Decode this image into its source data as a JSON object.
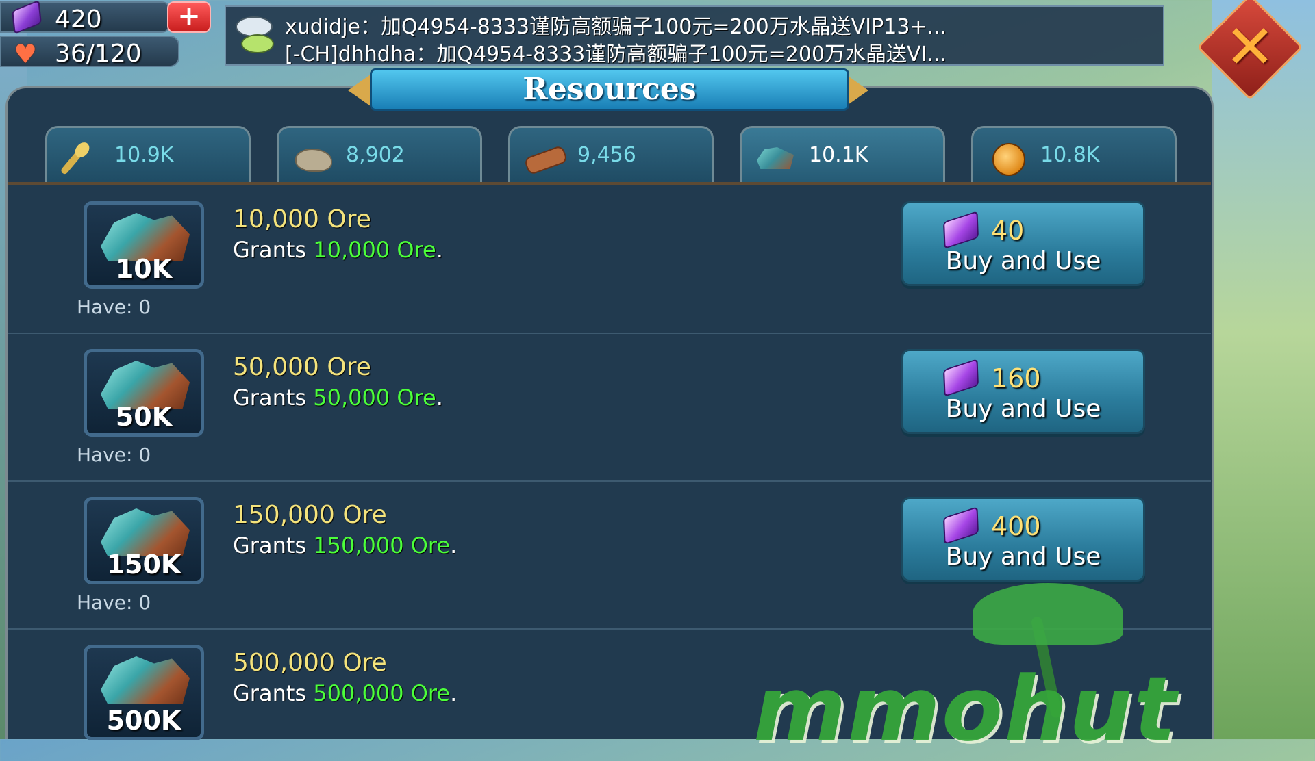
{
  "player": {
    "gems": "420",
    "energy": "36/120"
  },
  "chat": {
    "line1": "xudidje：加Q4954-8333谨防高额骗子100元=200万水晶送VIP13+...",
    "line2": "[-CH]dhhdha：加Q4954-8333谨防高额骗子100元=200万水晶送VI..."
  },
  "panel": {
    "title": "Resources"
  },
  "resources": [
    {
      "name": "food",
      "icon": "wheat-icon",
      "value": "10.9K"
    },
    {
      "name": "stone",
      "icon": "stone-icon",
      "value": "8,902"
    },
    {
      "name": "lumber",
      "icon": "wood-log-icon",
      "value": "9,456"
    },
    {
      "name": "ore",
      "icon": "ore-icon",
      "value": "10.1K"
    },
    {
      "name": "gold",
      "icon": "gold-coin-icon",
      "value": "10.8K"
    }
  ],
  "items": [
    {
      "amount": "10K",
      "title": "10,000 Ore",
      "desc_prefix": "Grants ",
      "desc_amount": "10,000 Ore",
      "desc_suffix": ".",
      "have": "Have: 0",
      "cost": "40",
      "button": "Buy and Use"
    },
    {
      "amount": "50K",
      "title": "50,000 Ore",
      "desc_prefix": "Grants ",
      "desc_amount": "50,000 Ore",
      "desc_suffix": ".",
      "have": "Have: 0",
      "cost": "160",
      "button": "Buy and Use"
    },
    {
      "amount": "150K",
      "title": "150,000 Ore",
      "desc_prefix": "Grants ",
      "desc_amount": "150,000 Ore",
      "desc_suffix": ".",
      "have": "Have: 0",
      "cost": "400",
      "button": "Buy and Use"
    },
    {
      "amount": "500K",
      "title": "500,000 Ore",
      "desc_prefix": "Grants ",
      "desc_amount": "500,000 Ore",
      "desc_suffix": ".",
      "have": "",
      "cost": "",
      "button": ""
    }
  ],
  "watermark": "mmohut",
  "colors": {
    "panel": "#213a4f",
    "highlight": "#4cff3a",
    "title_text": "#f4e37c",
    "button": "#2b7c9c"
  }
}
